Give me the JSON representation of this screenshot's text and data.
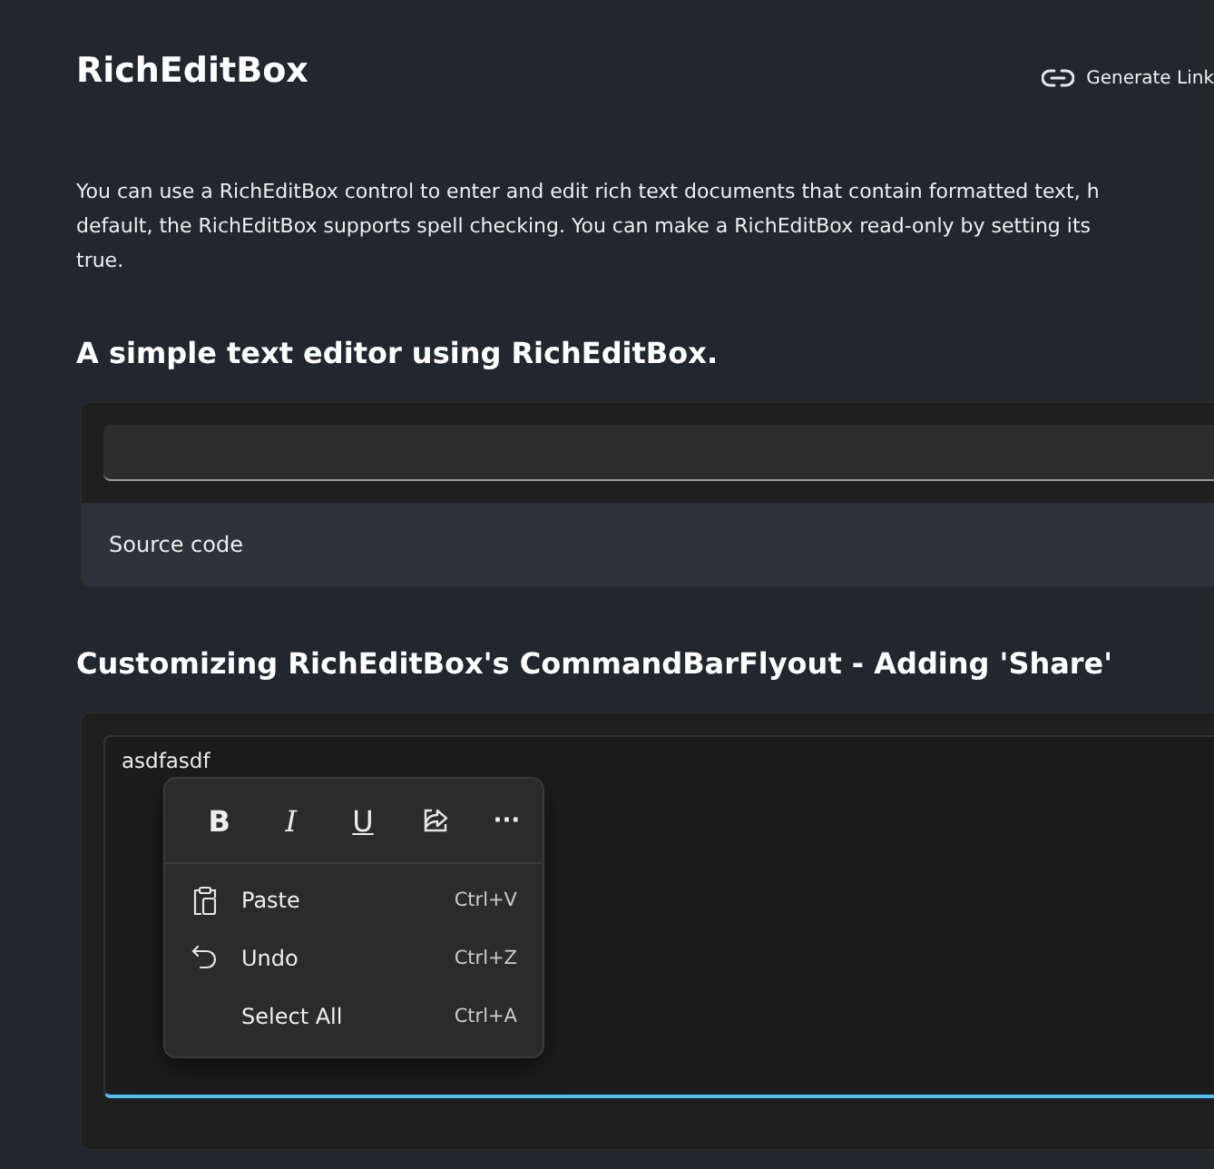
{
  "page": {
    "title": "RichEditBox",
    "share_link": "Generate Link",
    "description": [
      "You can use a RichEditBox control to enter and edit rich text documents that contain formatted text, h",
      "default, the RichEditBox supports spell checking. You can make a RichEditBox read-only by setting its",
      "true."
    ]
  },
  "examples": [
    {
      "heading": "A simple text editor using RichEditBox.",
      "editor": {
        "focused": false
      },
      "footer": "Source code"
    },
    {
      "heading": "Customizing RichEditBox's CommandBarFlyout - Adding 'Share'",
      "editor": {
        "value": "asdfasdf",
        "focused": true
      },
      "flyout": {
        "toolbar": [
          {
            "kind": "bold",
            "glyph": "B"
          },
          {
            "kind": "italic",
            "glyph": "I"
          },
          {
            "kind": "underline",
            "glyph": "U"
          },
          {
            "kind": "share"
          },
          {
            "kind": "more",
            "glyph": "···"
          }
        ],
        "items": [
          {
            "kind": "paste",
            "label": "Paste",
            "shortcut": "Ctrl+V"
          },
          {
            "kind": "undo",
            "label": "Undo",
            "shortcut": "Ctrl+Z"
          },
          {
            "kind": "plain",
            "label": "Select All",
            "shortcut": "Ctrl+A"
          }
        ]
      }
    }
  ]
}
